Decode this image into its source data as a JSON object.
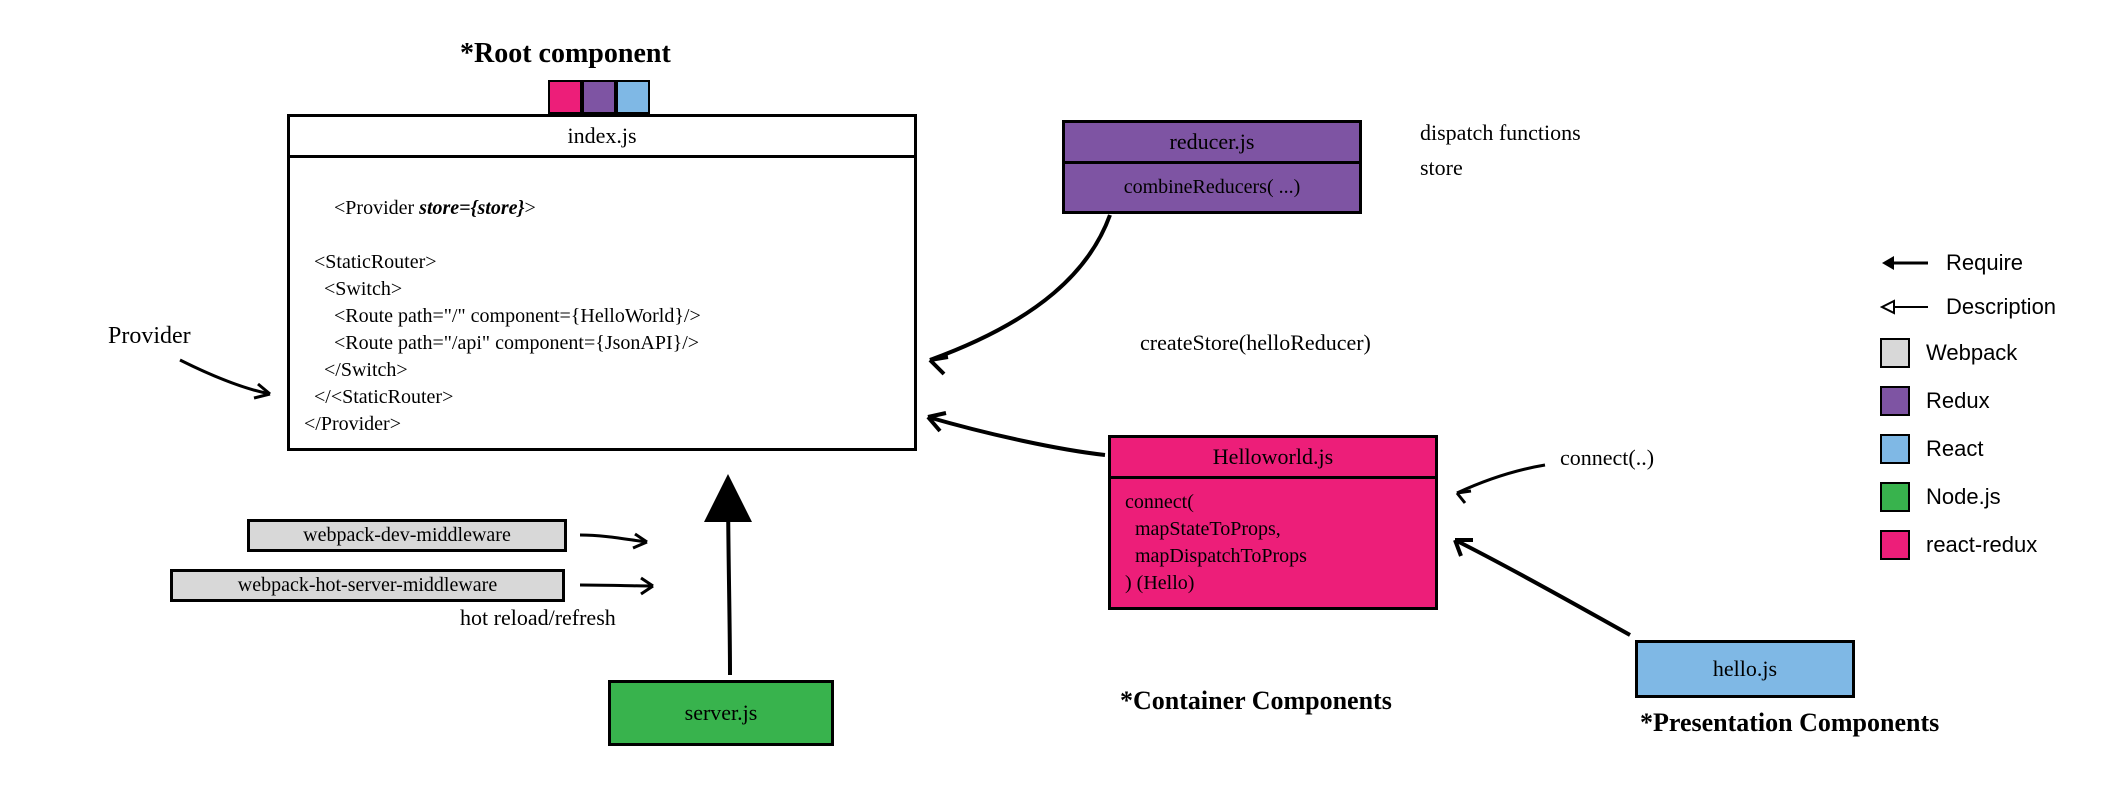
{
  "titles": {
    "root": "*Root component",
    "container": "*Container Components",
    "presentation": "*Presentation Components"
  },
  "index": {
    "title": "index.js",
    "code_l1": "<Provider ",
    "code_l1b": "store={store}",
    "code_l1c": ">",
    "code_l2": "  <StaticRouter>",
    "code_l3": "    <Switch>",
    "code_l4": "      <Route path=\"/\" component={HelloWorld}/>",
    "code_l5": "      <Route path=\"/api\" component={JsonAPI}/>",
    "code_l6": "    </Switch>",
    "code_l7": "  </<StaticRouter>",
    "code_l8": "</Provider>"
  },
  "reducer": {
    "title": "reducer.js",
    "body": "combineReducers( ...)"
  },
  "helloworld": {
    "title": "Helloworld.js",
    "body_l1": "connect(",
    "body_l2": "  mapStateToProps,",
    "body_l3": "  mapDispatchToProps",
    "body_l4": ") (Hello)"
  },
  "hello": {
    "title": "hello.js"
  },
  "server": {
    "title": "server.js"
  },
  "webpack": {
    "dev": "webpack-dev-middleware",
    "hot": "webpack-hot-server-middleware",
    "hot_note": "hot reload/refresh"
  },
  "labels": {
    "provider": "Provider",
    "createStore": "createStore(helloReducer)",
    "dispatch": "dispatch functions",
    "store": "store",
    "connect": "connect(..)"
  },
  "legend": {
    "require": "Require",
    "description": "Description",
    "webpack": "Webpack",
    "redux": "Redux",
    "react": "React",
    "node": "Node.js",
    "reactredux": "react-redux"
  },
  "colors": {
    "magenta": "#ED1E79",
    "purple": "#7E54A3",
    "blue": "#7FB8E5",
    "green": "#38B34D",
    "grey": "#D8D8D8"
  }
}
